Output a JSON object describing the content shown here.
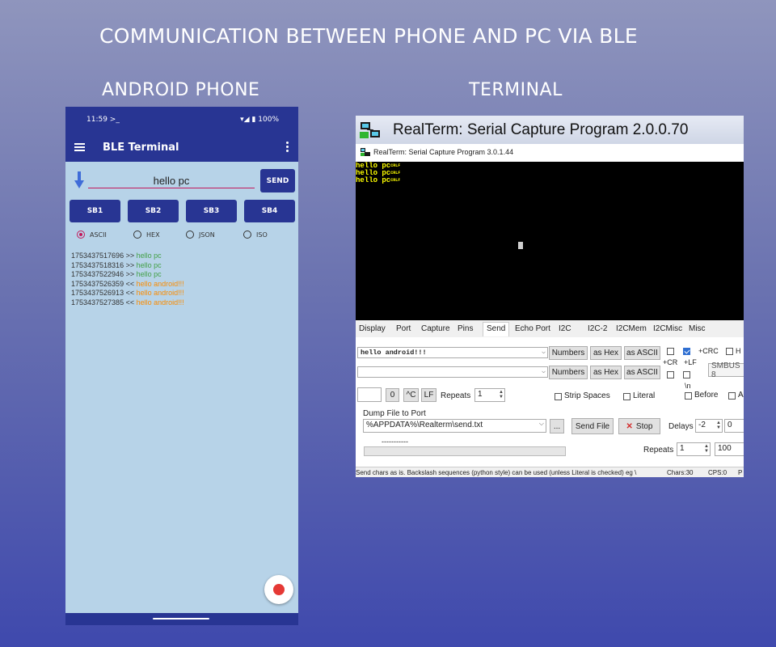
{
  "header": {
    "title": "COMMUNICATION BETWEEN PHONE AND PC VIA BLE",
    "left_caption": "ANDROID PHONE",
    "right_caption": "TERMINAL"
  },
  "phone": {
    "status_time": "11:59 >_",
    "status_right": "▾◢ ▮ 100%",
    "app_title": "BLE Terminal",
    "input_value": "hello pc",
    "send_label": "SEND",
    "sb_buttons": [
      "SB1",
      "SB2",
      "SB3",
      "SB4"
    ],
    "modes": [
      "ASCII",
      "HEX",
      "JSON",
      "ISO"
    ],
    "selected_mode": "ASCII",
    "log": [
      {
        "ts": "1753437517696",
        "dir": ">>",
        "msg": "hello pc"
      },
      {
        "ts": "1753437518316",
        "dir": ">>",
        "msg": "hello pc"
      },
      {
        "ts": "1753437522946",
        "dir": ">>",
        "msg": "hello pc"
      },
      {
        "ts": "1753437526359",
        "dir": "<<",
        "msg": "hello android!!!"
      },
      {
        "ts": "1753437526913",
        "dir": "<<",
        "msg": "hello android!!!"
      },
      {
        "ts": "1753437527385",
        "dir": "<<",
        "msg": "hello android!!!"
      }
    ],
    "colors": {
      "primary": "#283593",
      "background": "#b7d3e8",
      "sent": "#43a047",
      "received": "#fb8c00",
      "fab": "#e53935"
    }
  },
  "terminal": {
    "banner_title": "RealTerm: Serial Capture Program 2.0.0.70",
    "window_title": "RealTerm: Serial Capture Program 3.0.1.44",
    "screen_lines": [
      "hello pc",
      "hello pc",
      "hello pc"
    ],
    "line_end_glyph": "CRLF",
    "tabs": [
      "Display",
      "Port",
      "Capture",
      "Pins",
      "Send",
      "Echo Port",
      "I2C",
      "I2C-2",
      "I2CMem",
      "I2CMisc",
      "Misc"
    ],
    "active_tab": "Send",
    "send_field1": "hello android!!!",
    "send_field2": "",
    "btn_numbers": "Numbers",
    "btn_as_hex": "as Hex",
    "btn_as_ascii": "as ASCII",
    "lbl_plus_cr": "+CR",
    "lbl_plus_lf": "+LF",
    "lbl_plus_crc": "+CRC",
    "lbl_h": "H",
    "lbl_smbus": "SMBUS 8",
    "lbl_n": "\\n",
    "btn_zero": "0",
    "btn_ctrl_c": "^C",
    "btn_lf": "LF",
    "repeats_label": "Repeats",
    "repeats_value": "1",
    "strip_spaces": "Strip Spaces",
    "literal": "Literal",
    "before": "Before",
    "after_initial": "A",
    "dump_label": "Dump File to Port",
    "dump_path": "%APPDATA%\\Realterm\\send.txt",
    "btn_browse": "...",
    "btn_send_file": "Send File",
    "btn_stop": "Stop",
    "delays_label": "Delays",
    "delay1": "-2",
    "delay2": "0",
    "dashes": "-----------",
    "repeats2_label": "Repeats",
    "repeats2_value": "1",
    "repeats2_count": "100",
    "status_text": "Send chars as is. Backslash sequences (python style) can be used  (unless Literal is checked) eg \\",
    "status_chars": "Chars:30",
    "status_cps": "CPS:0",
    "status_p": "P"
  }
}
